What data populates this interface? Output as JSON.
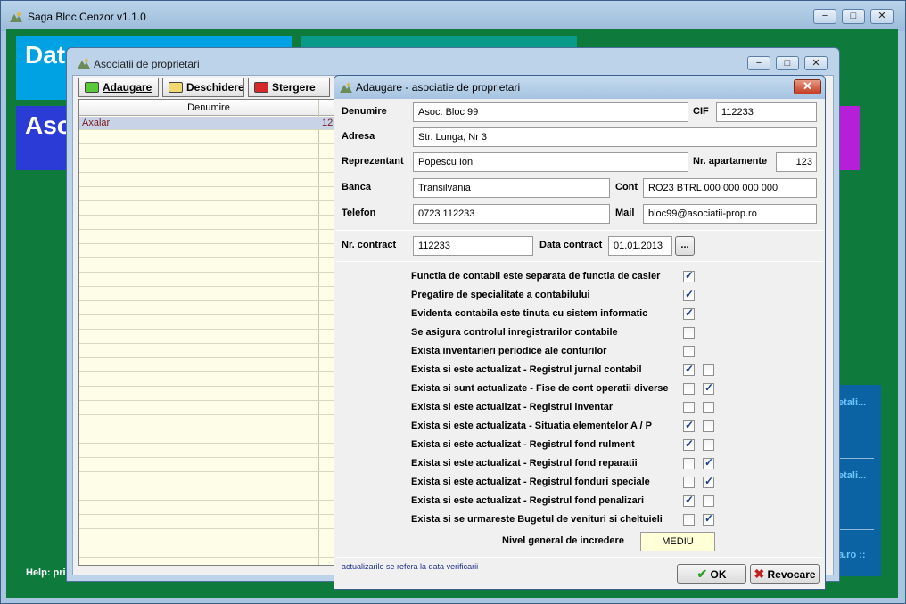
{
  "main": {
    "title": "Saga Bloc Cenzor v1.1.0",
    "minimize": "−",
    "maximize": "□",
    "close": "✕",
    "tiles": [
      "Dat",
      "Asoc"
    ],
    "help_text": "Help: pri",
    "side_links": [
      "etali...",
      "etali...",
      "a.ro ::"
    ]
  },
  "asoc_window": {
    "title": "Asociatii de proprietari",
    "toolbar": {
      "add": "Adaugare",
      "open": "Deschidere",
      "delete": "Stergere"
    },
    "grid": {
      "header": "Denumire",
      "rows": [
        {
          "name": "Axalar",
          "extra": "12"
        }
      ]
    }
  },
  "dialog": {
    "title": "Adaugare - asociatie de proprietari",
    "close": "✕",
    "fields": {
      "denumire": {
        "label": "Denumire",
        "value": "Asoc. Bloc 99"
      },
      "cif": {
        "label": "CIF",
        "value": "112233"
      },
      "adresa": {
        "label": "Adresa",
        "value": "Str. Lunga, Nr 3"
      },
      "reprezentant": {
        "label": "Reprezentant",
        "value": "Popescu Ion"
      },
      "nr_apartamente": {
        "label": "Nr. apartamente",
        "value": "123"
      },
      "banca": {
        "label": "Banca",
        "value": "Transilvania"
      },
      "cont": {
        "label": "Cont",
        "value": "RO23 BTRL 000 000 000 000"
      },
      "telefon": {
        "label": "Telefon",
        "value": "0723 112233"
      },
      "mail": {
        "label": "Mail",
        "value": "bloc99@asociatii-prop.ro"
      },
      "nr_contract": {
        "label": "Nr. contract",
        "value": "112233"
      },
      "data_contract": {
        "label": "Data contract",
        "value": "01.01.2013",
        "picker": "..."
      }
    },
    "checks": [
      {
        "label": "Functia de contabil este separata de functia de casier",
        "a": true
      },
      {
        "label": "Pregatire de specialitate a contabilului",
        "a": true
      },
      {
        "label": "Evidenta contabila este tinuta cu sistem informatic",
        "a": true
      },
      {
        "label": "Se asigura controlul inregistrarilor contabile",
        "a": false
      },
      {
        "label": "Exista inventarieri periodice ale conturilor",
        "a": false
      },
      {
        "label": "Exista si este actualizat - Registrul jurnal contabil",
        "a": true,
        "b": false
      },
      {
        "label": "Exista si sunt actualizate - Fise de cont operatii diverse",
        "a": false,
        "b": true
      },
      {
        "label": "Exista si este actualizat - Registrul inventar",
        "a": false,
        "b": false
      },
      {
        "label": "Exista si este actualizata - Situatia elementelor A / P",
        "a": true,
        "b": false
      },
      {
        "label": "Exista si este actualizat - Registrul fond rulment",
        "a": true,
        "b": false
      },
      {
        "label": "Exista si este actualizat - Registrul fond reparatii",
        "a": false,
        "b": true
      },
      {
        "label": "Exista si este actualizat - Registrul fonduri speciale",
        "a": false,
        "b": true
      },
      {
        "label": "Exista si este actualizat - Registrul fond penalizari",
        "a": true,
        "b": false
      },
      {
        "label": "Exista si se urmareste Bugetul de venituri si cheltuieli",
        "a": false,
        "b": true
      }
    ],
    "nivel": {
      "label": "Nivel general de incredere",
      "value": "MEDIU"
    },
    "footer_note": "actualizarile se refera la data verificarii",
    "ok": "OK",
    "cancel": "Revocare"
  }
}
